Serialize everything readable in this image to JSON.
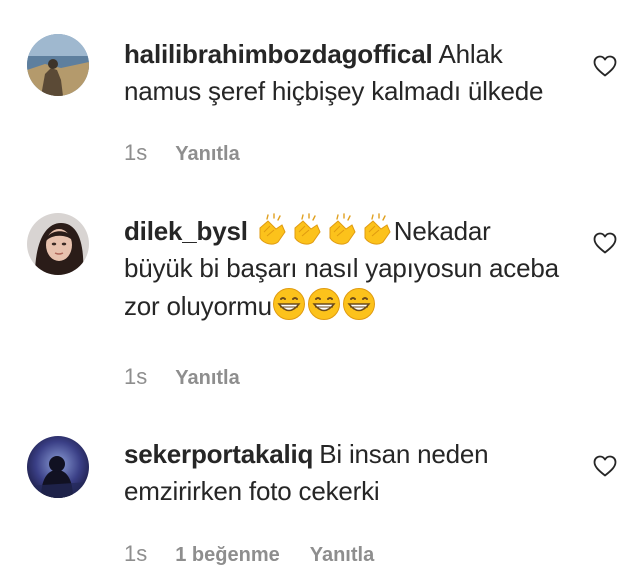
{
  "comments": [
    {
      "username": "halilibrahimbozdagoffical",
      "text": "Ahlak namus şeref hiçbişey kalmadı ülkede",
      "time": "1s",
      "reply_label": "Yanıtla"
    },
    {
      "username": "dilek_bysl",
      "text_prefix_emojis": [
        "clapping-hands",
        "clapping-hands",
        "clapping-hands",
        "clapping-hands"
      ],
      "text_main": "Nekadar büyük bi başarı nasıl yapıyosun aceba zor oluyormu",
      "text_suffix_emojis": [
        "grinning-face",
        "grinning-face",
        "grinning-face"
      ],
      "time": "1s",
      "reply_label": "Yanıtla"
    },
    {
      "username": "sekerportakaliq",
      "text": "Bi insan neden emzirirken foto cekerki",
      "time": "1s",
      "likes": "1 beğenme",
      "reply_label": "Yanıtla"
    }
  ],
  "icons": {
    "like": "heart-outline-icon"
  },
  "colors": {
    "text": "#262626",
    "meta": "#8e8e8e"
  }
}
